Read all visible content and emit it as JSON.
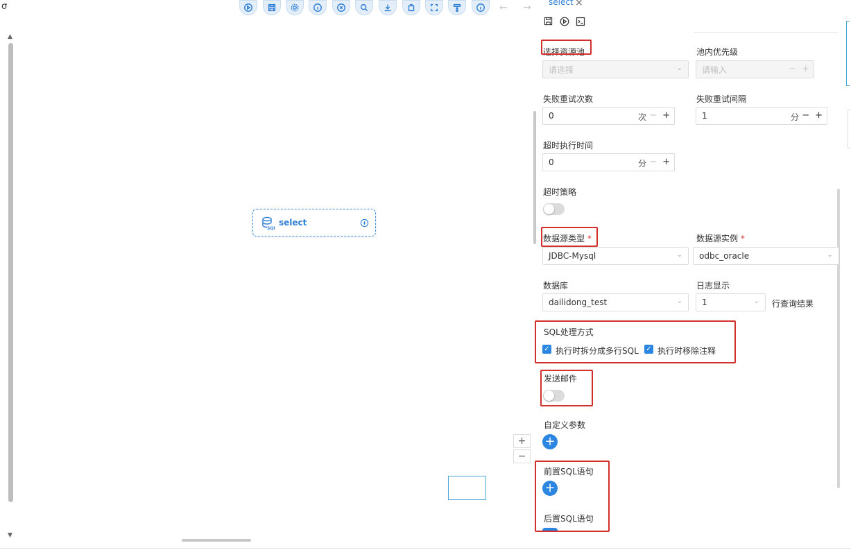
{
  "toolbar": {
    "icons": [
      "play-icon",
      "save-icon",
      "settings-icon",
      "info-icon",
      "close-circle-icon",
      "search-icon",
      "download-icon",
      "delete-icon",
      "fullscreen-icon",
      "format-icon",
      "info-icon"
    ],
    "back_arrow": "←",
    "forward_arrow": "→"
  },
  "corner_glyph": "σ",
  "canvas": {
    "node_label": "select",
    "zoom_in": "+",
    "zoom_out": "−"
  },
  "panel": {
    "tab_label": "select",
    "tab_close": "×",
    "select_pool": {
      "label": "选择资源池",
      "placeholder": "请选择"
    },
    "pool_priority": {
      "label": "池内优先级",
      "placeholder": "请输入"
    },
    "retry_times": {
      "label": "失败重试次数",
      "value": "0",
      "unit": "次"
    },
    "retry_interval": {
      "label": "失败重试间隔",
      "value": "1",
      "unit": "分"
    },
    "timeout": {
      "label": "超时执行时间",
      "value": "0",
      "unit": "分"
    },
    "timeout_strategy": {
      "label": "超时策略",
      "on": false
    },
    "datasource_type": {
      "label": "数据源类型",
      "required": "*",
      "value": "JDBC-Mysql"
    },
    "datasource_instance": {
      "label": "数据源实例",
      "required": "*",
      "value": "odbc_oracle"
    },
    "database": {
      "label": "数据库",
      "value": "dailidong_test"
    },
    "log_display": {
      "label": "日志显示",
      "value": "1",
      "suffix": "行查询结果"
    },
    "sql_mode": {
      "label": "SQL处理方式",
      "options": [
        {
          "label": "执行时拆分成多行SQL",
          "checked": true
        },
        {
          "label": "执行时移除注释",
          "checked": true
        }
      ]
    },
    "send_mail": {
      "label": "发送邮件",
      "on": false
    },
    "custom_params": {
      "label": "自定义参数"
    },
    "pre_sql": {
      "label": "前置SQL语句"
    },
    "post_sql": {
      "label": "后置SQL语句"
    },
    "plus": "+",
    "minus": "−",
    "check": "✓"
  }
}
